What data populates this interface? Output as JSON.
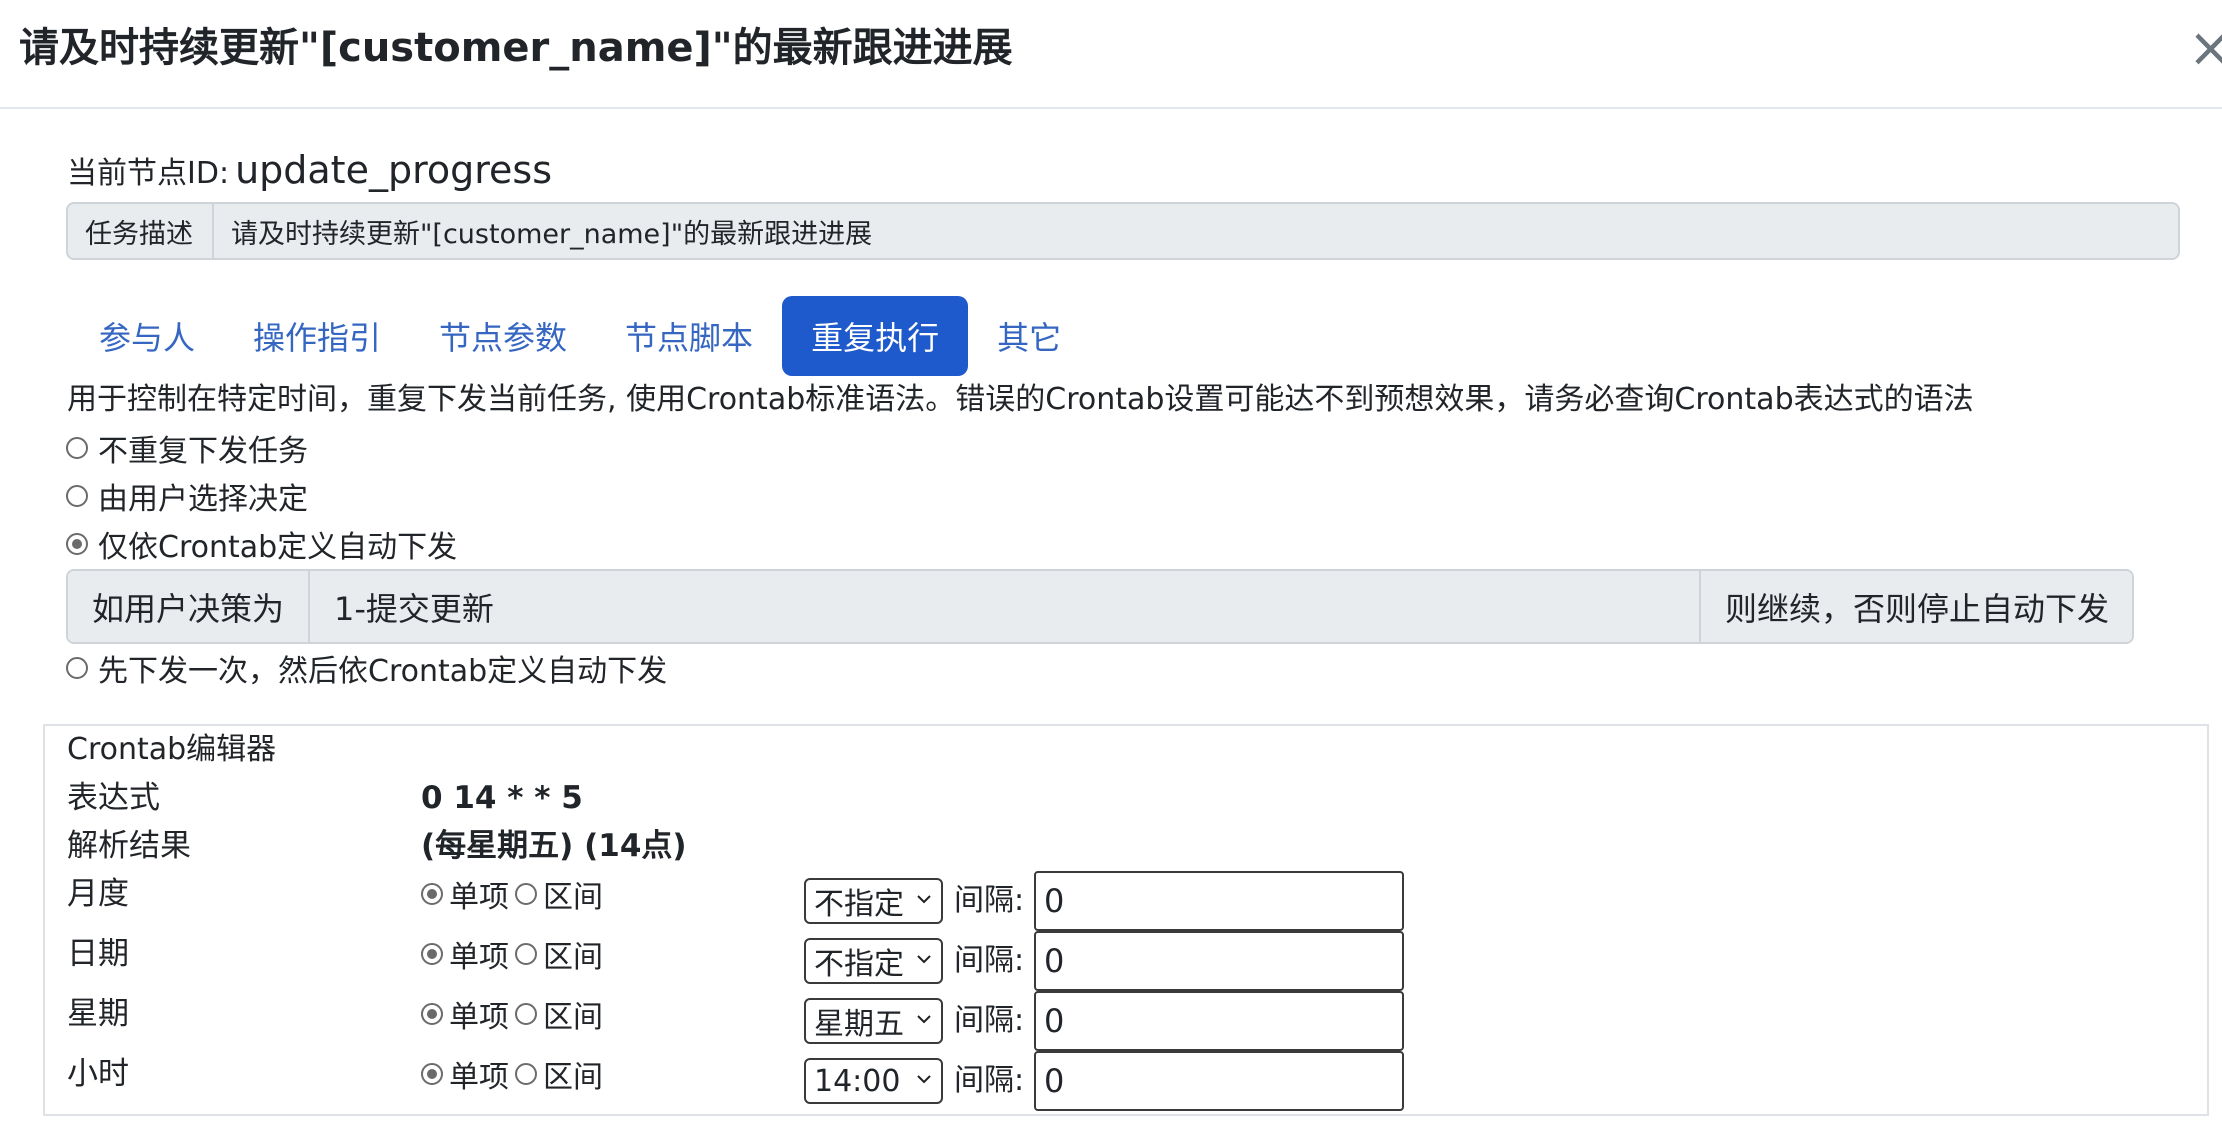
{
  "modal": {
    "title": "请及时持续更新\"[customer_name]\"的最新跟进进展",
    "close_glyph": "×"
  },
  "node": {
    "id_label": "当前节点ID:",
    "id_value": "update_progress"
  },
  "task": {
    "label": "任务描述",
    "description": "请及时持续更新\"[customer_name]\"的最新跟进进展"
  },
  "tabs": [
    {
      "label": "参与人",
      "active": false
    },
    {
      "label": "操作指引",
      "active": false
    },
    {
      "label": "节点参数",
      "active": false
    },
    {
      "label": "节点脚本",
      "active": false
    },
    {
      "label": "重复执行",
      "active": true
    },
    {
      "label": "其它",
      "active": false
    }
  ],
  "repeat": {
    "description": "用于控制在特定时间，重复下发当前任务, 使用Crontab标准语法。错误的Crontab设置可能达不到预想效果，请务必查询Crontab表达式的语法",
    "options": [
      {
        "label": "不重复下发任务",
        "checked": false
      },
      {
        "label": "由用户选择决定",
        "checked": false
      },
      {
        "label": "仅依Crontab定义自动下发",
        "checked": true
      },
      {
        "label": "先下发一次，然后依Crontab定义自动下发",
        "checked": false
      }
    ],
    "decision": {
      "prefix": "如用户决策为",
      "value": "1-提交更新",
      "suffix": "则继续，否则停止自动下发"
    }
  },
  "crontab": {
    "title": "Crontab编辑器",
    "expression_label": "表达式",
    "expression_value": "0 14 * * 5",
    "parse_label": "解析结果",
    "parse_value": "(每星期五) (14点)",
    "single_label": "单项",
    "range_label": "区间",
    "interval_label": "间隔:",
    "rows": [
      {
        "label": "月度",
        "mode": "single",
        "select": "不指定",
        "interval": "0"
      },
      {
        "label": "日期",
        "mode": "single",
        "select": "不指定",
        "interval": "0"
      },
      {
        "label": "星期",
        "mode": "single",
        "select": "星期五",
        "interval": "0"
      },
      {
        "label": "小时",
        "mode": "single",
        "select": "14:00",
        "interval": "0"
      }
    ]
  }
}
